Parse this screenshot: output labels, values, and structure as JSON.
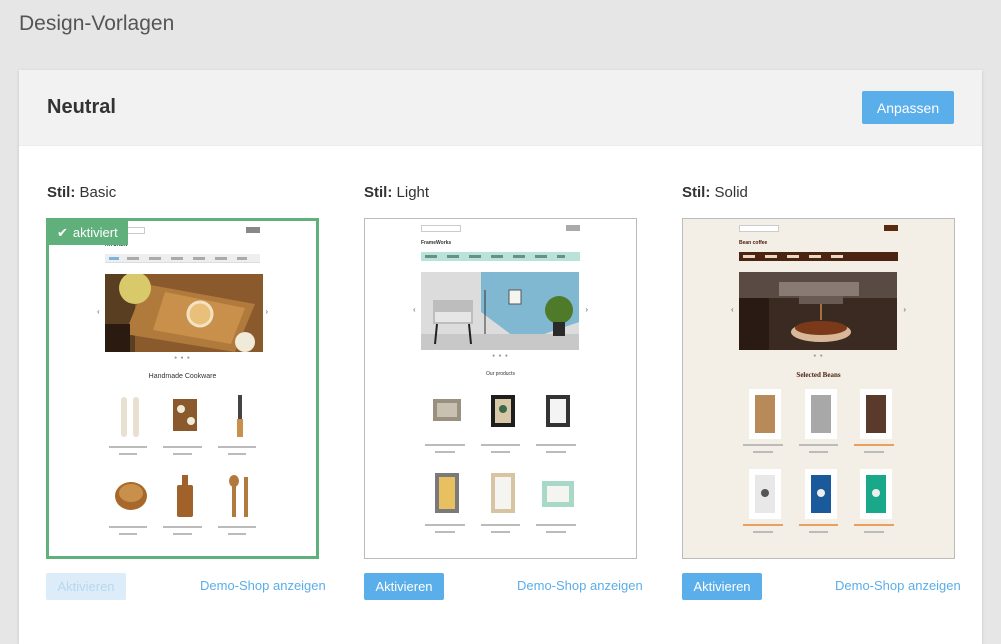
{
  "page": {
    "title": "Design-Vorlagen"
  },
  "panel": {
    "title": "Neutral",
    "customize_label": "Anpassen"
  },
  "templates": [
    {
      "style_prefix": "Stil:",
      "style_name": "Basic",
      "active": true,
      "badge_label": "aktiviert",
      "activate_label": "Aktivieren",
      "demo_label": "Demo-Shop anzeigen",
      "preview": {
        "shop_name": "KITCHEN",
        "section_title": "Handmade Cookware",
        "accent": "#7ab3e0"
      }
    },
    {
      "style_prefix": "Stil:",
      "style_name": "Light",
      "active": false,
      "activate_label": "Aktivieren",
      "demo_label": "Demo-Shop anzeigen",
      "preview": {
        "shop_name": "FrameWorks",
        "section_title": "Our products",
        "accent": "#b9e3d8"
      }
    },
    {
      "style_prefix": "Stil:",
      "style_name": "Solid",
      "active": false,
      "activate_label": "Aktivieren",
      "demo_label": "Demo-Shop anzeigen",
      "preview": {
        "shop_name": "Bean coffee",
        "section_title": "Selected Beans",
        "accent": "#4a2410"
      }
    }
  ],
  "colors": {
    "primary": "#5aaeea",
    "active_border": "#5fb07a",
    "panel_header_bg": "#f2f2f2",
    "page_bg": "#e6e6e6"
  }
}
